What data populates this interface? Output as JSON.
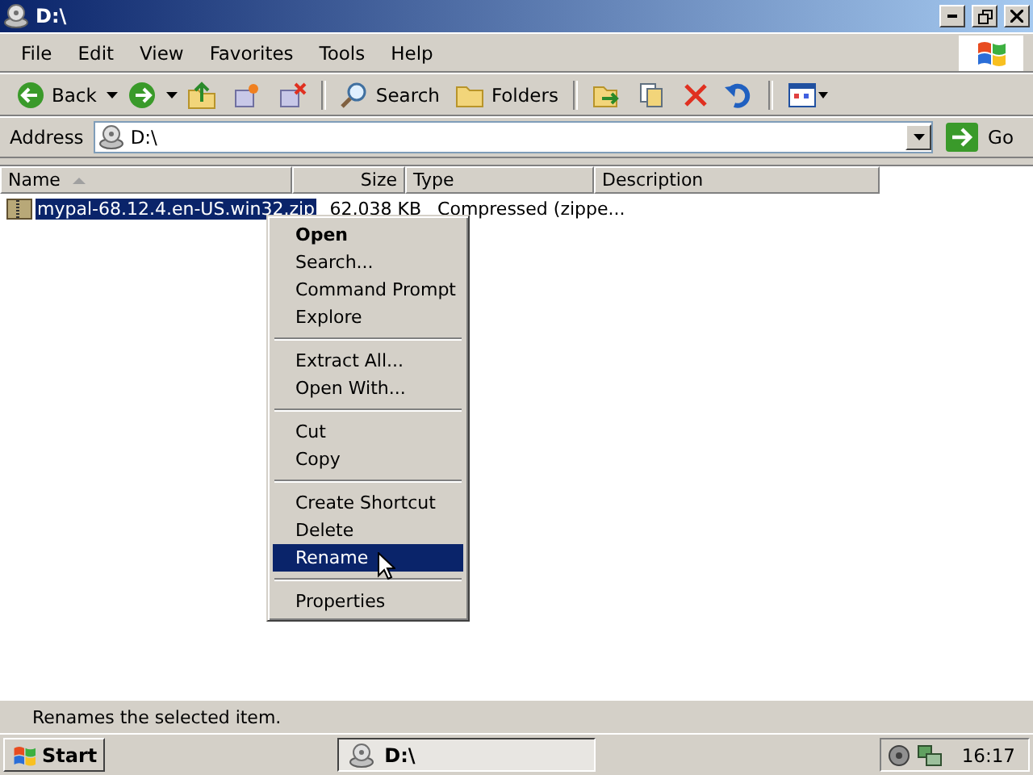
{
  "window": {
    "title": "D:\\"
  },
  "menu_bar": [
    "File",
    "Edit",
    "View",
    "Favorites",
    "Tools",
    "Help"
  ],
  "toolbar": [
    {
      "kind": "back",
      "label": "Back"
    },
    {
      "kind": "forward"
    },
    {
      "kind": "up"
    },
    {
      "kind": "folder-plus"
    },
    {
      "kind": "folder-x"
    },
    {
      "kind": "search",
      "label": "Search"
    },
    {
      "kind": "folders",
      "label": "Folders"
    },
    {
      "kind": "move"
    },
    {
      "kind": "copy"
    },
    {
      "kind": "delete"
    },
    {
      "kind": "undo"
    },
    {
      "kind": "views"
    }
  ],
  "address": {
    "label": "Address",
    "value": "D:\\",
    "go": "Go"
  },
  "columns": [
    {
      "label": "Name",
      "sorted": true
    },
    {
      "label": "Size",
      "sorted": false
    },
    {
      "label": "Type",
      "sorted": false
    },
    {
      "label": "Description",
      "sorted": false
    }
  ],
  "rows": [
    {
      "name": "mypal-68.12.4.en-US.win32.zip",
      "size": "62,038 KB",
      "type": "Compressed (zippe...",
      "selected": true
    }
  ],
  "context_menu": [
    {
      "kind": "item",
      "label": "Open",
      "default": true,
      "selected": false
    },
    {
      "kind": "item",
      "label": "Search...",
      "default": false,
      "selected": false
    },
    {
      "kind": "item",
      "label": "Command Prompt",
      "default": false,
      "selected": false
    },
    {
      "kind": "item",
      "label": "Explore",
      "default": false,
      "selected": false
    },
    {
      "kind": "separator"
    },
    {
      "kind": "item",
      "label": "Extract All...",
      "default": false,
      "selected": false
    },
    {
      "kind": "item",
      "label": "Open With...",
      "default": false,
      "selected": false
    },
    {
      "kind": "separator"
    },
    {
      "kind": "item",
      "label": "Cut",
      "default": false,
      "selected": false
    },
    {
      "kind": "item",
      "label": "Copy",
      "default": false,
      "selected": false
    },
    {
      "kind": "separator"
    },
    {
      "kind": "item",
      "label": "Create Shortcut",
      "default": false,
      "selected": false
    },
    {
      "kind": "item",
      "label": "Delete",
      "default": false,
      "selected": false
    },
    {
      "kind": "item",
      "label": "Rename",
      "default": false,
      "selected": true
    },
    {
      "kind": "separator"
    },
    {
      "kind": "item",
      "label": "Properties",
      "default": false,
      "selected": false
    }
  ],
  "status_bar": "Renames the selected item.",
  "taskbar": {
    "start": "Start",
    "tasks": [
      {
        "label": "D:\\",
        "selected": true
      }
    ],
    "clock": "16:17"
  }
}
